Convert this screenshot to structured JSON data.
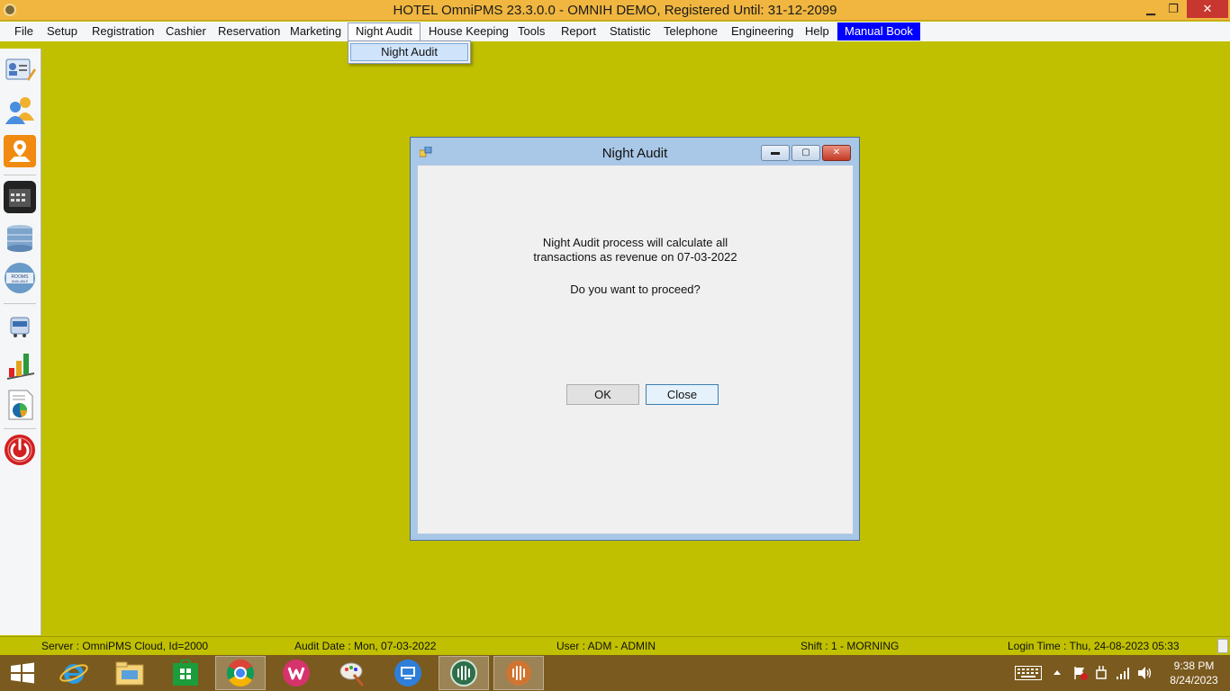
{
  "window": {
    "title": "HOTEL OmniPMS 23.3.0.0 - OMNIH DEMO, Registered Until: 31-12-2099",
    "min_glyph": "▁",
    "max_glyph": "❐",
    "close_glyph": "✕"
  },
  "menu": {
    "items": [
      "File",
      "Setup",
      "Registration",
      "Cashier",
      "Reservation",
      "Marketing",
      "Night Audit",
      "House Keeping",
      "Tools",
      "Report",
      "Statistic",
      "Telephone",
      "Engineering",
      "Help",
      "Manual Book"
    ],
    "active": "Night Audit",
    "dropdown": [
      "Night Audit"
    ]
  },
  "toolbar_icons": [
    "guest-card-icon",
    "guests-icon",
    "map-icon",
    "calendar-icon",
    "server-icon",
    "rooms-available-icon",
    "cart-icon",
    "chart-icon",
    "report-pie-icon",
    "power-icon"
  ],
  "rooms_icon_text": [
    "ROOMS",
    "AVAILABLE"
  ],
  "dialog": {
    "title": "Night Audit",
    "message_line1": "Night Audit process will calculate all",
    "message_line2": "transactions as revenue on 07-03-2022",
    "question": "Do you want to proceed?",
    "ok_label": "OK",
    "close_label": "Close"
  },
  "status": {
    "server": "Server : OmniPMS Cloud, Id=2000",
    "audit_date": "Audit Date : Mon, 07-03-2022",
    "user": "User : ADM - ADMIN",
    "shift": "Shift : 1 - MORNING",
    "login_time": "Login Time : Thu, 24-08-2023 05:33"
  },
  "taskbar": {
    "apps": [
      "internet-explorer-icon",
      "file-explorer-icon",
      "store-icon",
      "chrome-icon",
      "wps-office-icon",
      "paint-icon",
      "remote-desktop-icon",
      "omnipms-icon",
      "audio-app-icon"
    ],
    "time": "9:38 PM",
    "date": "8/24/2023"
  },
  "colors": {
    "desktop": "#c0c000",
    "titlebar": "#f0b63f",
    "taskbar": "#7a5a1e",
    "manual_book_bg": "#0000ff"
  }
}
